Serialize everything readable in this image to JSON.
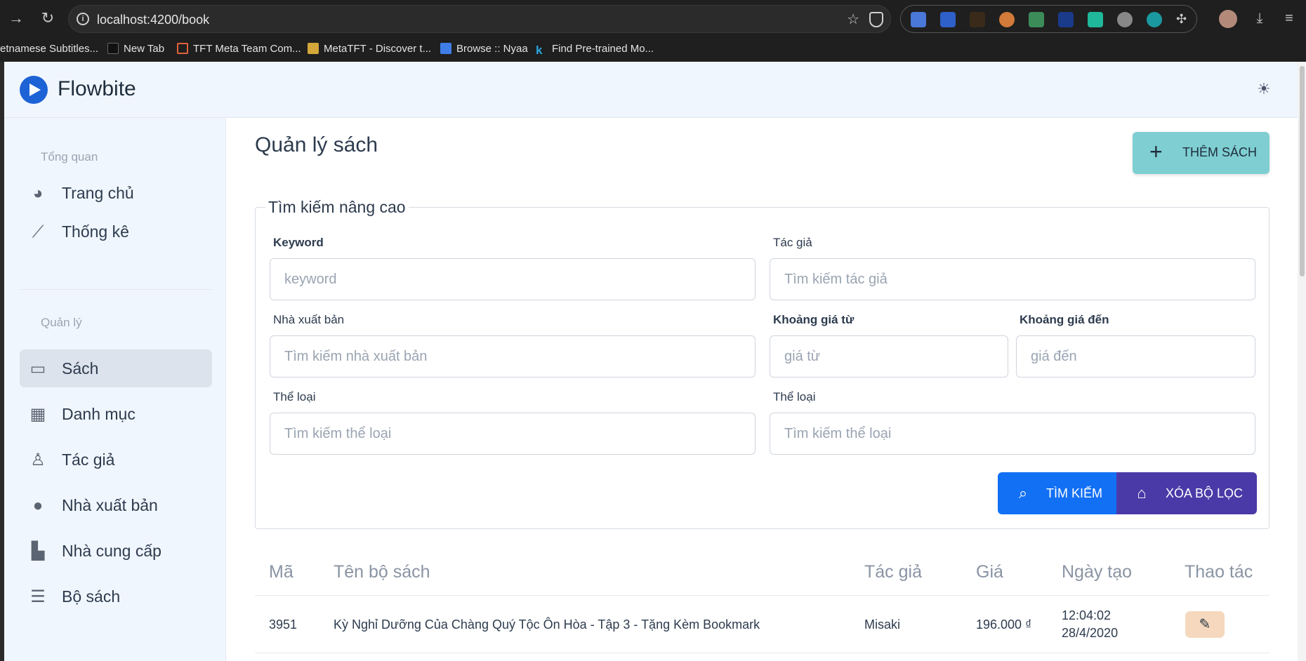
{
  "browser": {
    "url": "localhost:4200/book",
    "bookmarks": [
      {
        "label": "etnamese Subtitles...",
        "icon": "subtitle-icon",
        "color": "#444444"
      },
      {
        "label": "New Tab",
        "icon": "ht-icon",
        "color": "#111111"
      },
      {
        "label": "TFT Meta Team Com...",
        "icon": "tft-icon",
        "color": "#e0623b"
      },
      {
        "label": "MetaTFT - Discover t...",
        "icon": "metatft-icon",
        "color": "#d4a73a"
      },
      {
        "label": "Browse :: Nyaa",
        "icon": "nyaa-icon",
        "color": "#3f7ee8"
      },
      {
        "label": "Find Pre-trained Mo...",
        "icon": "k-icon",
        "color": "#2aa7e0"
      }
    ]
  },
  "header": {
    "brand": "Flowbite",
    "theme_icon": "sun-icon"
  },
  "sidebar": {
    "section_overview": "Tổng quan",
    "section_manage": "Quản lý",
    "overview_items": [
      {
        "label": "Trang chủ",
        "icon": "dashboard-icon",
        "glyph": "◕"
      },
      {
        "label": "Thống kê",
        "icon": "chart-icon",
        "glyph": "⟋"
      }
    ],
    "manage_items": [
      {
        "label": "Sách",
        "icon": "book-icon",
        "glyph": "▭",
        "active": true
      },
      {
        "label": "Danh mục",
        "icon": "category-icon",
        "glyph": "▦"
      },
      {
        "label": "Tác giả",
        "icon": "user-icon",
        "glyph": "♙"
      },
      {
        "label": "Nhà xuất bản",
        "icon": "globe-icon",
        "glyph": "●"
      },
      {
        "label": "Nhà cung cấp",
        "icon": "factory-icon",
        "glyph": "▙"
      },
      {
        "label": "Bộ sách",
        "icon": "layers-icon",
        "glyph": "☰"
      }
    ]
  },
  "main": {
    "title": "Quản lý sách",
    "add_button": "THÊM SÁCH",
    "search": {
      "legend": "Tìm kiếm nâng cao",
      "fields": {
        "keyword": {
          "label": "Keyword",
          "placeholder": "keyword"
        },
        "author": {
          "label": "Tác giả",
          "placeholder": "Tìm kiếm tác giả"
        },
        "publisher": {
          "label": "Nhà xuất bản",
          "placeholder": "Tìm kiếm nhà xuất bản"
        },
        "price_from": {
          "label": "Khoảng giá từ",
          "placeholder": "giá từ"
        },
        "price_to": {
          "label": "Khoảng giá đến",
          "placeholder": "giá đến"
        },
        "category1": {
          "label": "Thể loại",
          "placeholder": "Tìm kiếm thể loại"
        },
        "category2": {
          "label": "Thể loại",
          "placeholder": "Tìm kiếm thể loại"
        }
      },
      "search_button": "TÌM KIẾM",
      "clear_button": "XÓA BỘ LỌC"
    },
    "table": {
      "columns": [
        "Mã",
        "Tên bộ sách",
        "Tác giả",
        "Giá",
        "Ngày tạo",
        "Thao tác"
      ],
      "rows": [
        {
          "id": "3951",
          "name": "Kỳ Nghỉ Dưỡng Của Chàng Quý Tộc Ôn Hòa - Tập 3 - Tặng Kèm Bookmark",
          "author": "Misaki",
          "price": "196.000 ₫",
          "time": "12:04:02",
          "date": "28/4/2020"
        }
      ]
    }
  },
  "colors": {
    "accent_blue": "#1270f5",
    "accent_purple": "#4a3aa8",
    "add_button": "#7fcfd2",
    "edit_button": "#f5d8bd"
  }
}
